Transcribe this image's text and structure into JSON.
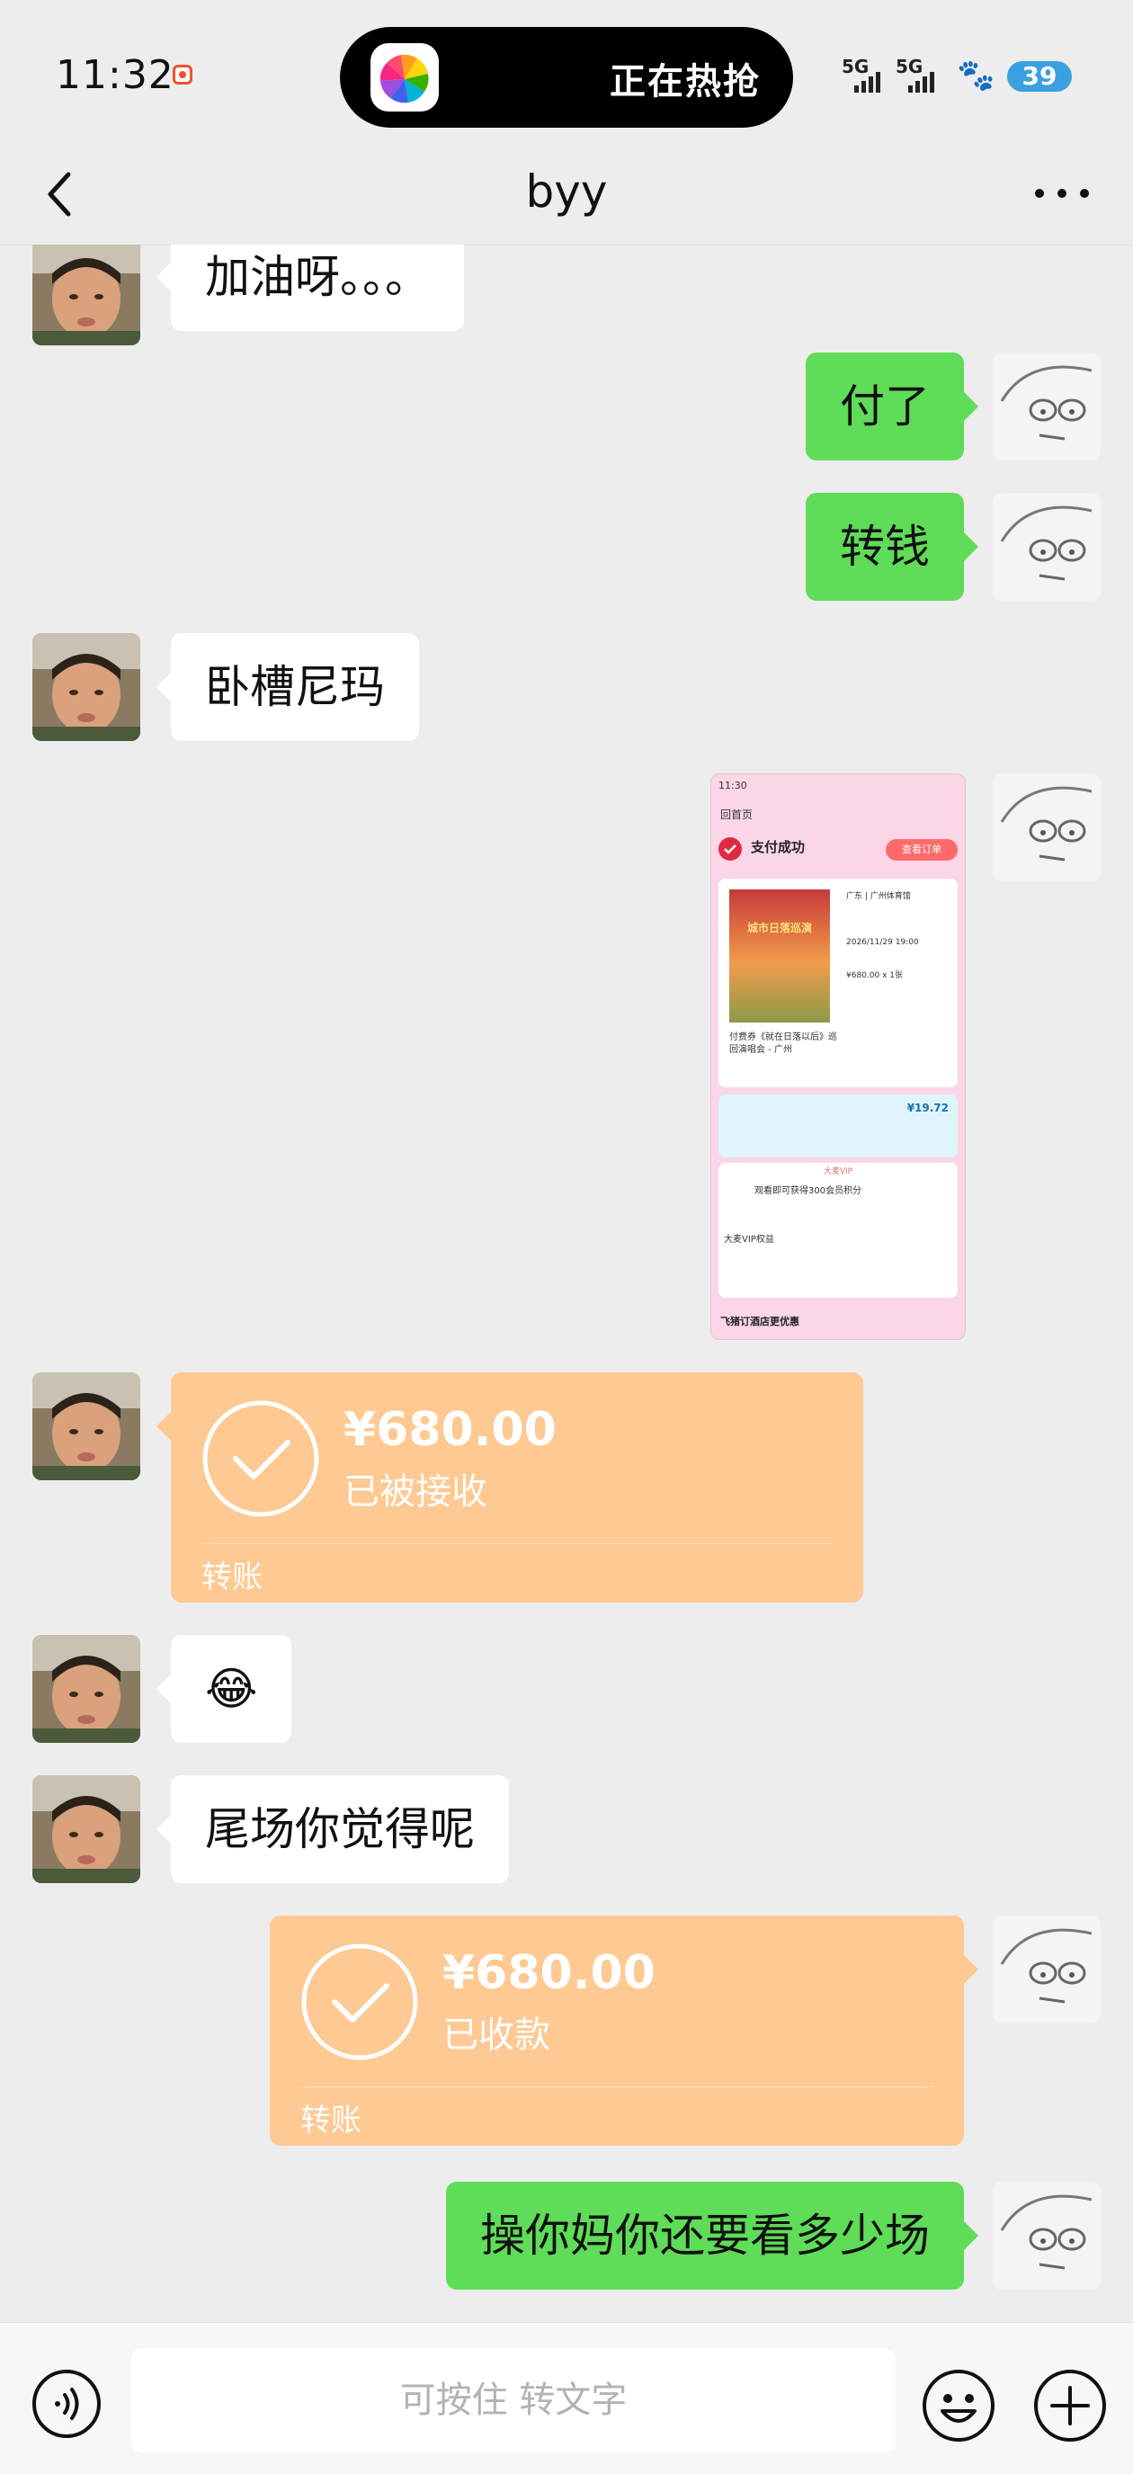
{
  "status_bar": {
    "time": "11:32",
    "island_text": "正在热抢",
    "sim1": "5G",
    "sim2": "5G",
    "battery": "39"
  },
  "nav": {
    "title": "byy"
  },
  "messages": [
    {
      "side": "in",
      "text": "加油呀。。。"
    },
    {
      "side": "out",
      "text": "付了"
    },
    {
      "side": "out",
      "text": "转钱"
    },
    {
      "side": "in",
      "text": "卧槽尼玛"
    },
    {
      "side": "out",
      "type": "image"
    },
    {
      "side": "in",
      "type": "transfer",
      "amount": "¥680.00",
      "status": "已被接收",
      "label": "转账"
    },
    {
      "side": "in",
      "text": "😂"
    },
    {
      "side": "in",
      "text": "尾场你觉得呢"
    },
    {
      "side": "out",
      "type": "transfer",
      "amount": "¥680.00",
      "status": "已收款",
      "label": "转账"
    },
    {
      "side": "out",
      "text": "操你妈你还要看多少场"
    }
  ],
  "screenshot": {
    "time": "11:30",
    "back": "回首页",
    "pay_success": "支付成功",
    "view_order": "查看订单",
    "poster_title": "城市日落巡演",
    "venue": "广东 | 广州体育馆",
    "date": "2026/11/29 19:00",
    "price": "¥680.00 x 1张",
    "show_name": "付费券《就在日落以后》巡回演唱会 - 广州",
    "deal_price": "¥19.72",
    "vip_title": "大麦VIP",
    "vip_line": "观看即可获得300会员积分",
    "benefit_title": "大麦VIP权益",
    "footer": "飞猪订酒店更优惠"
  },
  "bottom_bar": {
    "placeholder": "可按住 转文字"
  },
  "colors": {
    "background": "#ededed",
    "outgoing_bubble": "#5fdc58",
    "incoming_bubble": "#ffffff",
    "transfer_card": "#fec992",
    "battery": "#3aa0e0"
  }
}
